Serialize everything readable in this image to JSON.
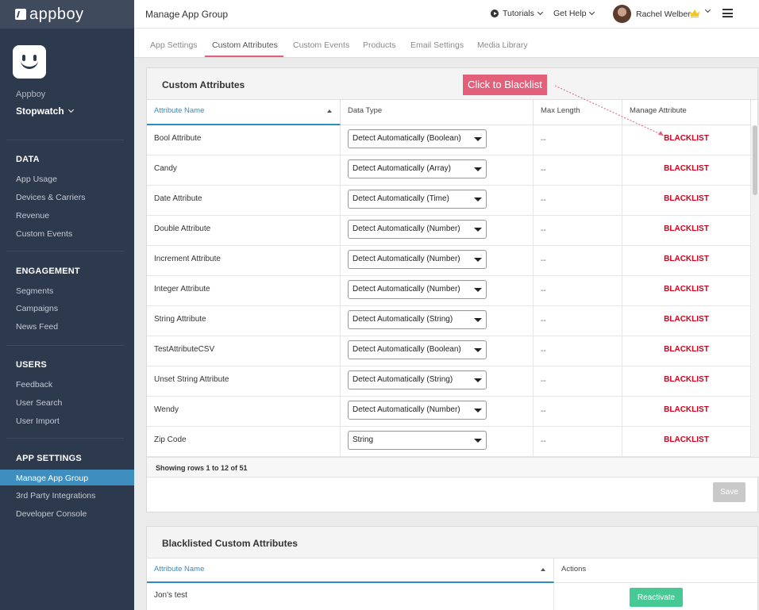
{
  "sidebar": {
    "logo": "appboy",
    "company": "Appboy",
    "app": "Stopwatch",
    "sections": [
      {
        "title": "DATA",
        "items": [
          "App Usage",
          "Devices & Carriers",
          "Revenue",
          "Custom Events"
        ]
      },
      {
        "title": "ENGAGEMENT",
        "items": [
          "Segments",
          "Campaigns",
          "News Feed"
        ]
      },
      {
        "title": "USERS",
        "items": [
          "Feedback",
          "User Search",
          "User Import"
        ]
      },
      {
        "title": "APP SETTINGS",
        "items": [
          "Manage App Group",
          "3rd Party Integrations",
          "Developer Console"
        ]
      }
    ],
    "active_item": "Manage App Group"
  },
  "topbar": {
    "title": "Manage App Group",
    "tutorials": "Tutorials",
    "help": "Get Help",
    "user": "Rachel Welber"
  },
  "tabs": [
    "App Settings",
    "Custom Attributes",
    "Custom Events",
    "Products",
    "Email Settings",
    "Media Library"
  ],
  "active_tab": "Custom Attributes",
  "callout": "Click to Blacklist",
  "custom_attributes": {
    "title": "Custom Attributes",
    "columns": [
      "Attribute Name",
      "Data Type",
      "Max Length",
      "Manage Attribute"
    ],
    "rows": [
      {
        "name": "Bool Attribute",
        "type": "Detect Automatically (Boolean)",
        "max": "--",
        "action": "BLACKLIST"
      },
      {
        "name": "Candy",
        "type": "Detect Automatically (Array)",
        "max": "--",
        "action": "BLACKLIST"
      },
      {
        "name": "Date Attribute",
        "type": "Detect Automatically (Time)",
        "max": "--",
        "action": "BLACKLIST"
      },
      {
        "name": "Double Attribute",
        "type": "Detect Automatically (Number)",
        "max": "--",
        "action": "BLACKLIST"
      },
      {
        "name": "Increment Attribute",
        "type": "Detect Automatically (Number)",
        "max": "--",
        "action": "BLACKLIST"
      },
      {
        "name": "Integer Attribute",
        "type": "Detect Automatically (Number)",
        "max": "--",
        "action": "BLACKLIST"
      },
      {
        "name": "String Attribute",
        "type": "Detect Automatically (String)",
        "max": "--",
        "action": "BLACKLIST"
      },
      {
        "name": "TestAttributeCSV",
        "type": "Detect Automatically (Boolean)",
        "max": "--",
        "action": "BLACKLIST"
      },
      {
        "name": "Unset String Attribute",
        "type": "Detect Automatically (String)",
        "max": "--",
        "action": "BLACKLIST"
      },
      {
        "name": "Wendy",
        "type": "Detect Automatically (Number)",
        "max": "--",
        "action": "BLACKLIST"
      },
      {
        "name": "Zip Code",
        "type": "String",
        "max": "--",
        "action": "BLACKLIST"
      }
    ],
    "row_count": "Showing rows 1 to 12 of 51",
    "save_label": "Save"
  },
  "blacklisted": {
    "title": "Blacklisted Custom Attributes",
    "columns": [
      "Attribute Name",
      "Actions"
    ],
    "rows": [
      {
        "name": "Jon's test",
        "action": "Reactivate"
      }
    ]
  },
  "colors": {
    "sidebar": "#2d3a4e",
    "accent_pink": "#e3607b",
    "link_blue": "#2d8ec3",
    "blacklist_red": "#d0021b",
    "reactivate_green": "#46c995"
  }
}
